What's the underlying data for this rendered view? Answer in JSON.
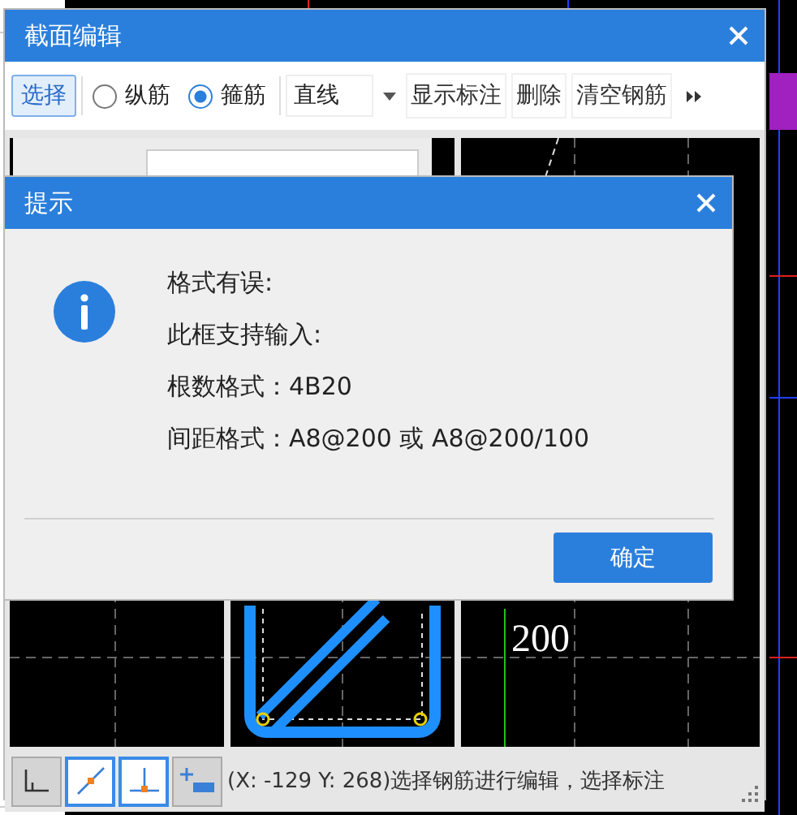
{
  "main_window": {
    "title": "截面编辑"
  },
  "toolbar": {
    "select_button": {
      "label": "选择",
      "selected": true
    },
    "radios": [
      {
        "label": "纵筋",
        "selected": false
      },
      {
        "label": "箍筋",
        "selected": true
      }
    ],
    "line_dropdown": {
      "value": "直线"
    },
    "buttons": [
      "显示标注",
      "删除",
      "清空钢筋"
    ]
  },
  "canvas": {
    "dimension_label": "200"
  },
  "status_bar": {
    "tools": [
      {
        "kind": "corner",
        "selected": false
      },
      {
        "kind": "slope",
        "selected": true
      },
      {
        "kind": "perpendicular",
        "selected": true
      },
      {
        "kind": "add",
        "selected": false
      }
    ],
    "message": "(X: -129 Y: 268)选择钢筋进行编辑，选择标注"
  },
  "dialog": {
    "title": "提示",
    "lines": [
      "格式有误:",
      "此框支持输入:",
      "根数格式：4B20",
      "间距格式：A8@200 或 A8@200/100"
    ],
    "ok_button": "确定"
  }
}
